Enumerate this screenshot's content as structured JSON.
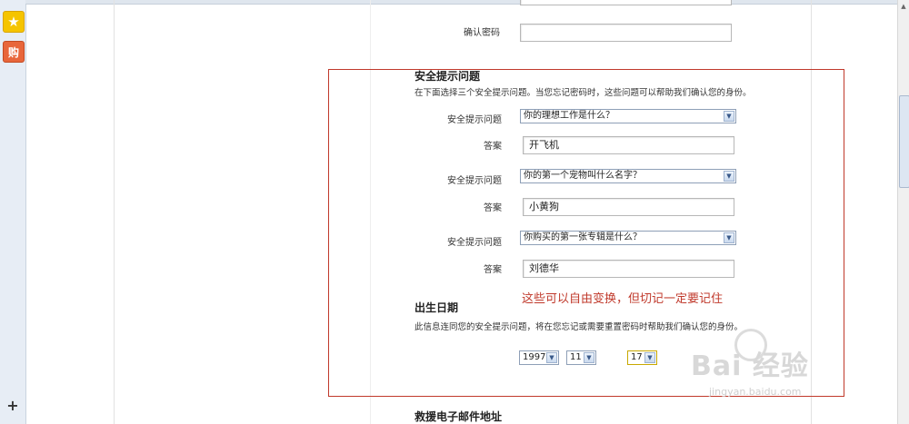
{
  "left_toolbar": {
    "shop_label": "购",
    "add_label": "+"
  },
  "confirm_password": {
    "label": "确认密码",
    "value": ""
  },
  "security": {
    "title": "安全提示问题",
    "desc": "在下面选择三个安全提示问题。当您忘记密码时，这些问题可以帮助我们确认您的身份。",
    "questions": [
      {
        "label": "安全提示问题",
        "selected": "你的理想工作是什么？",
        "answer_label": "答案",
        "answer": "开飞机"
      },
      {
        "label": "安全提示问题",
        "selected": "你的第一个宠物叫什么名字？",
        "answer_label": "答案",
        "answer": "小黄狗"
      },
      {
        "label": "安全提示问题",
        "selected": "你购买的第一张专辑是什么？",
        "answer_label": "答案",
        "answer": "刘德华"
      }
    ]
  },
  "annotation": {
    "text": "这些可以自由变换，但切记一定要记住",
    "color": "#c0392b"
  },
  "birthday": {
    "title": "出生日期",
    "desc": "此信息连同您的安全提示问题，将在您忘记或需要重置密码时帮助我们确认您的身份。",
    "year": "1997",
    "month": "11",
    "day": "17"
  },
  "rescue_email": {
    "title": "救援电子邮件地址"
  },
  "watermark": {
    "brand": "Bai 经验",
    "url": "jingyan.baidu.com"
  }
}
